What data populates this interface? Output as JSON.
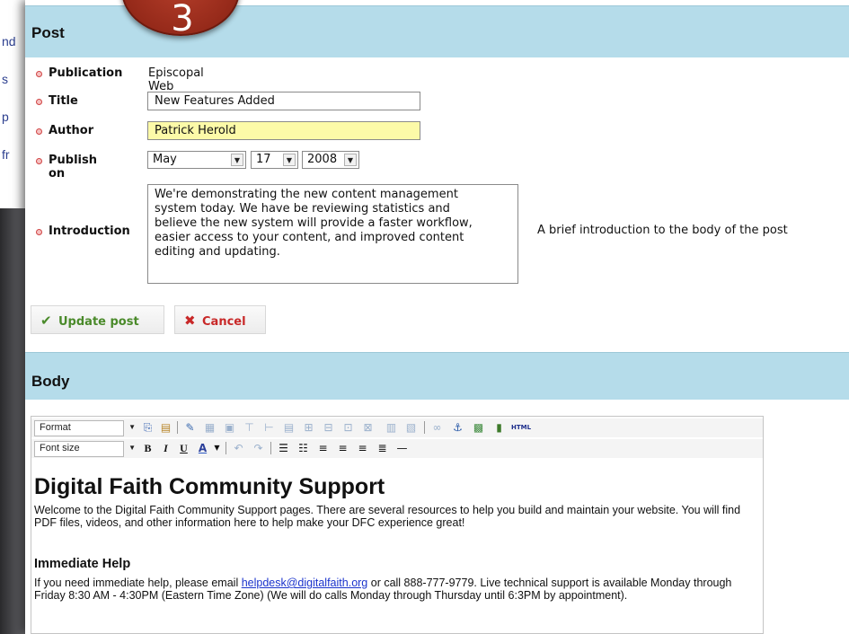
{
  "background_fragments": [
    "nd",
    "s",
    "p",
    "fr"
  ],
  "step_badge": "3",
  "post_section": {
    "title": "Post",
    "publication": {
      "label": "Publication",
      "value": "Episcopal Web News"
    },
    "title_field": {
      "label": "Title",
      "value": "New Features Added"
    },
    "author_field": {
      "label": "Author",
      "value": "Patrick Herold"
    },
    "publish_on": {
      "label": "Publish on",
      "month": "May",
      "day": "17",
      "year": "2008"
    },
    "introduction": {
      "label": "Introduction",
      "value": "We're demonstrating the new content management\nsystem today. We have be reviewing statistics and\nbelieve the new system will provide a faster workflow,\neasier access to your content, and improved content\nediting and updating.",
      "helper": "A brief introduction to the body of the post"
    },
    "update_button": "Update post",
    "cancel_button": "Cancel"
  },
  "body_section": {
    "title": "Body",
    "format_select": "Format",
    "font_size_select": "Font size",
    "heading": "Digital Faith Community Support",
    "intro_paragraph": "Welcome to the Digital Faith Community Support pages. There are several resources to help you build and maintain your website. You will find PDF files, videos, and other information here to help make your DFC experience great!",
    "subheading": "Immediate Help",
    "help_text_before": "If you need immediate help, please email ",
    "help_email": "helpdesk@digitalfaith.org",
    "help_text_after": " or call 888-777-9779. Live technical support is available Monday through Friday 8:30 AM - 4:30PM (Eastern Time Zone) (We will do calls Monday through Thursday until 6:3PM by appointment)."
  },
  "colors": {
    "section_header": "#b5dcea",
    "author_highlight": "#fcfaa8",
    "badge": "#962a1a",
    "update_green": "#4a8a2a",
    "cancel_red": "#c82828"
  }
}
